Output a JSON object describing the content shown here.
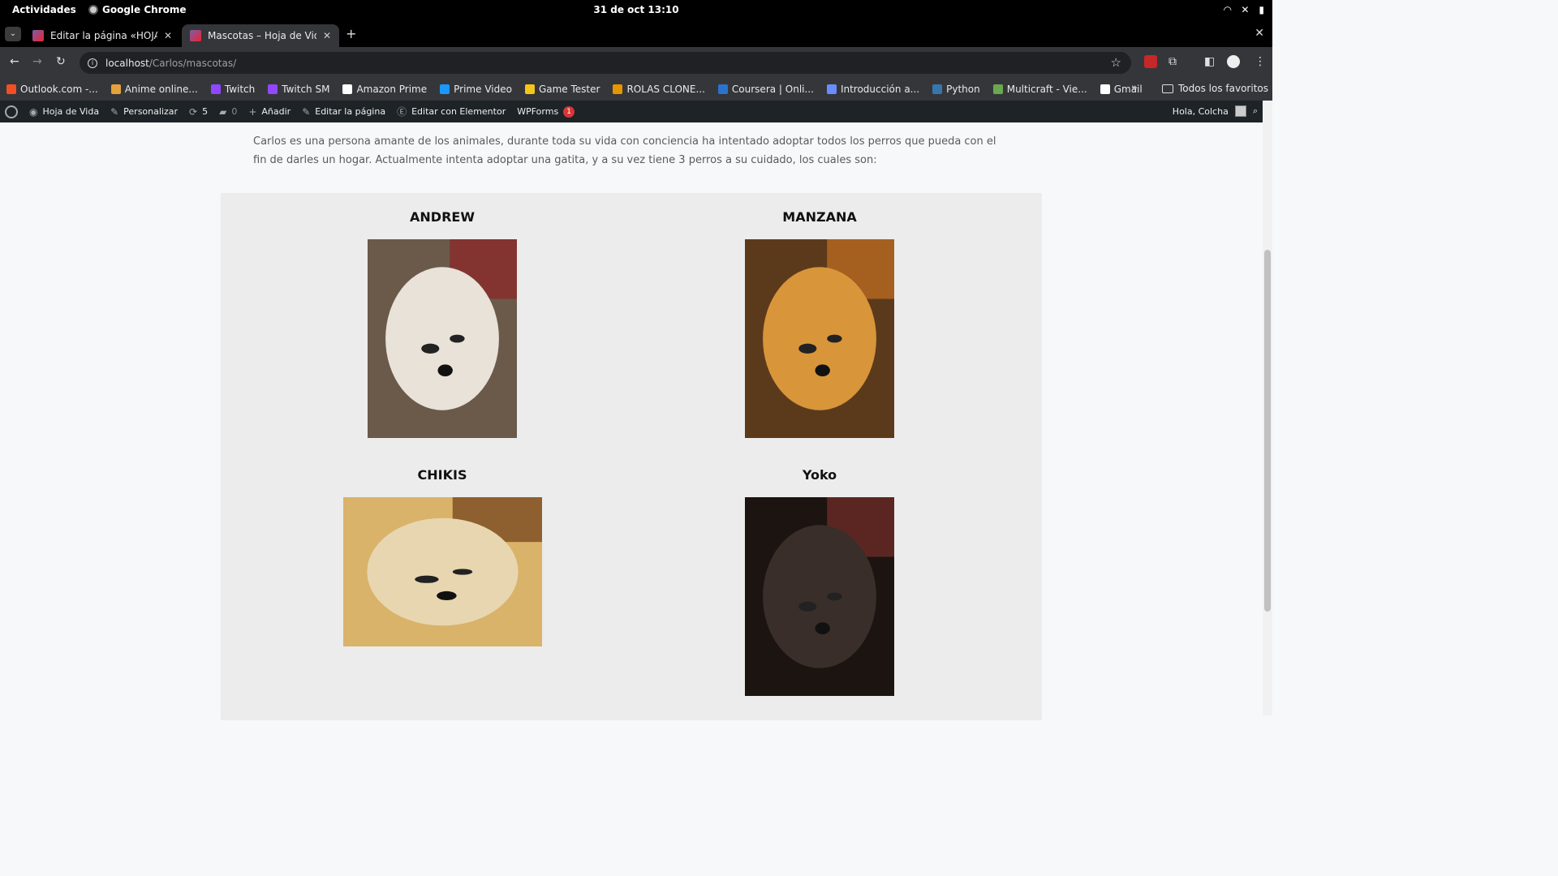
{
  "system": {
    "activities": "Actividades",
    "app_name": "Google Chrome",
    "clock": "31 de oct  13:10"
  },
  "tabs": [
    {
      "title": "Editar la página «HOJA D",
      "active": false
    },
    {
      "title": "Mascotas – Hoja de Vida",
      "active": true
    }
  ],
  "address": {
    "host": "localhost",
    "path": "/Carlos/mascotas/"
  },
  "bookmarks": [
    {
      "label": "Outlook.com -...",
      "color": "#f25022"
    },
    {
      "label": "Anime online...",
      "color": "#e5a13b"
    },
    {
      "label": "Twitch",
      "color": "#9146ff"
    },
    {
      "label": "Twitch SM",
      "color": "#9146ff"
    },
    {
      "label": "Amazon Prime",
      "color": "#ffffff"
    },
    {
      "label": "Prime Video",
      "color": "#1a98ff"
    },
    {
      "label": "Game Tester",
      "color": "#f5c518"
    },
    {
      "label": "ROLAS CLONE...",
      "color": "#e59500"
    },
    {
      "label": "Coursera | Onli...",
      "color": "#2a73cc"
    },
    {
      "label": "Introducción a...",
      "color": "#6b8cff"
    },
    {
      "label": "Python",
      "color": "#3776ab"
    },
    {
      "label": "Multicraft - Vie...",
      "color": "#6aa84f"
    },
    {
      "label": "Gmail",
      "color": "#ffffff"
    }
  ],
  "bookmarks_more": "»",
  "all_favorites": "Todos los favoritos",
  "wp_admin": {
    "site": "Hoja de Vida",
    "customize": "Personalizar",
    "updates": "5",
    "comments": "0",
    "add": "Añadir",
    "edit_page": "Editar la página",
    "elementor": "Editar con Elementor",
    "wpforms": "WPForms",
    "wpforms_count": "1",
    "greeting": "Hola, Colcha"
  },
  "page": {
    "intro": "Carlos es una persona amante de los animales, durante toda su vida con conciencia ha intentado adoptar todos los perros que pueda con el fin de darles un hogar. Actualmente intenta adoptar una gatita, y a su vez tiene 3 perros a su cuidado, los cuales son:",
    "pets": [
      {
        "name": "ANDREW",
        "fur": "#e8e2d8",
        "bg": "#6b5a4a",
        "accent": "#8a2a2a"
      },
      {
        "name": "MANZANA",
        "fur": "#d9953a",
        "bg": "#5b3a1c",
        "accent": "#b86a20"
      },
      {
        "name": "CHIKIS",
        "fur": "#e8d6b0",
        "bg": "#d9b36a",
        "accent": "#7a4a20"
      },
      {
        "name": "Yoko",
        "fur": "#3a2e2a",
        "bg": "#1c1410",
        "accent": "#6b2b25"
      }
    ]
  }
}
